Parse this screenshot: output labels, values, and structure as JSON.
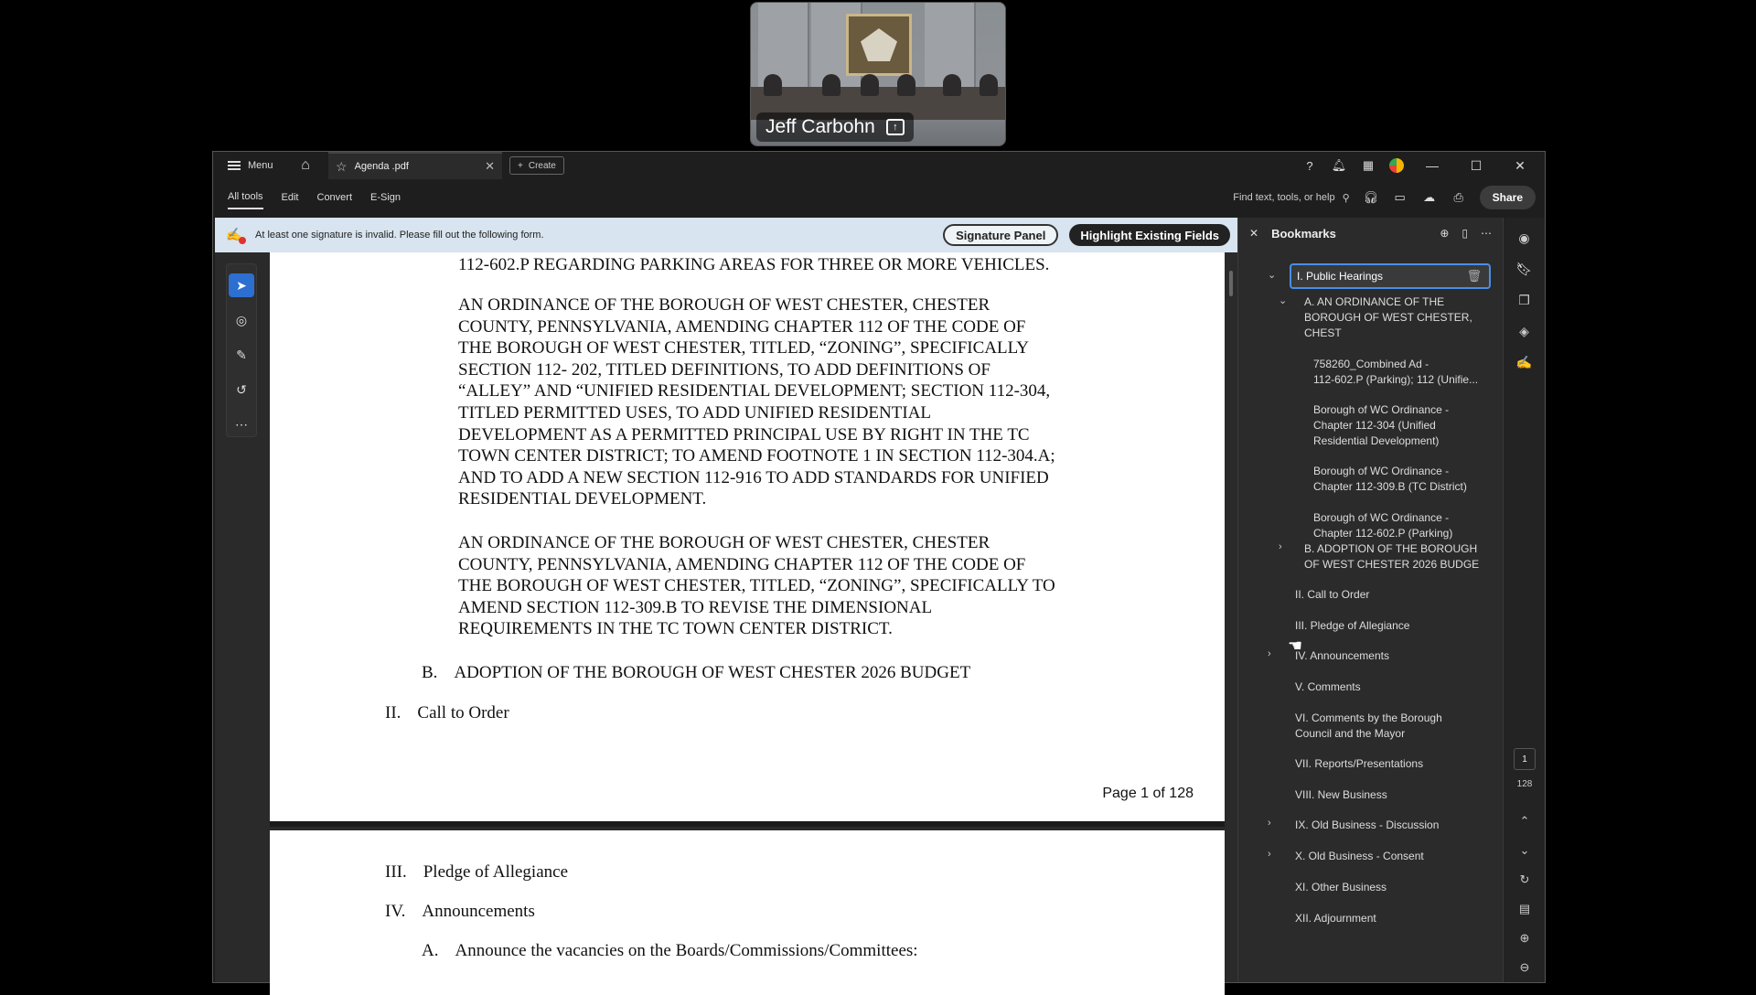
{
  "video": {
    "participant_name": "Jeff Carbohn",
    "share_icon": "share-screen-icon"
  },
  "titlebar": {
    "menu_label": "Menu",
    "tab_label": "Agenda .pdf",
    "create_label": "Create"
  },
  "toolbar": {
    "tabs": [
      "All tools",
      "Edit",
      "Convert",
      "E-Sign"
    ],
    "find_placeholder": "Find text, tools, or help",
    "share_label": "Share"
  },
  "notice": {
    "message": "At least one signature is invalid.  Please fill out the following form.",
    "signature_panel_label": "Signature Panel",
    "highlight_fields_label": "Highlight Existing Fields"
  },
  "document": {
    "top_line": "112-602.P REGARDING PARKING AREAS FOR THREE OR MORE VEHICLES.",
    "para1": "AN ORDINANCE OF THE BOROUGH OF WEST CHESTER, CHESTER\nCOUNTY, PENNSYLVANIA, AMENDING CHAPTER 112 OF THE CODE OF\nTHE BOROUGH OF WEST CHESTER, TITLED, “ZONING”, SPECIFICALLY\nSECTION 112- 202, TITLED DEFINITIONS, TO ADD DEFINITIONS OF\n“ALLEY” AND “UNIFIED RESIDENTIAL DEVELOPMENT; SECTION 112-304,\nTITLED PERMITTED USES, TO ADD UNIFIED RESIDENTIAL\nDEVELOPMENT AS A PERMITTED PRINCIPAL USE BY RIGHT IN THE TC\nTOWN CENTER DISTRICT; TO AMEND FOOTNOTE 1 IN SECTION 112-304.A;\nAND TO ADD A NEW SECTION 112-916 TO ADD STANDARDS FOR UNIFIED\nRESIDENTIAL DEVELOPMENT.",
    "para2": "AN ORDINANCE OF THE BOROUGH OF WEST CHESTER, CHESTER\nCOUNTY, PENNSYLVANIA, AMENDING CHAPTER 112 OF THE CODE OF\nTHE BOROUGH OF WEST CHESTER, TITLED, “ZONING”, SPECIFICALLY TO\nAMEND SECTION 112-309.B TO REVISE THE DIMENSIONAL\nREQUIREMENTS IN THE TC TOWN CENTER DISTRICT.",
    "b_marker": "B.",
    "b_text": "ADOPTION OF THE BOROUGH OF WEST CHESTER 2026 BUDGET",
    "ii_marker": "II.",
    "ii_text": "Call to Order",
    "page_label": "Page 1 of 128",
    "iii_marker": "III.",
    "iii_text": "Pledge of Allegiance",
    "iv_marker": "IV.",
    "iv_text": "Announcements",
    "a_marker": "A.",
    "a_text": "Announce the vacancies on the Boards/Commissions/Committees:"
  },
  "bookmarks": {
    "title": "Bookmarks",
    "selected": "I. Public Hearings",
    "items": [
      "A. AN ORDINANCE OF THE\nBOROUGH OF WEST CHESTER,\nCHEST",
      "758260_Combined Ad -\n112-602.P (Parking); 112 (Unifie...",
      "Borough of WC Ordinance -\nChapter 112-304 (Unified\nResidential Development)",
      "Borough of WC Ordinance -\nChapter 112-309.B (TC District)",
      "Borough of WC Ordinance -\nChapter 112-602.P (Parking)",
      "B. ADOPTION OF THE BOROUGH\nOF WEST CHESTER 2026 BUDGE",
      "II. Call to Order",
      "III. Pledge of Allegiance",
      "IV. Announcements",
      "V.  Comments",
      "VI. Comments by the Borough\nCouncil and the Mayor",
      "VII. Reports/Presentations",
      "VIII. New Business",
      "IX. Old Business - Discussion",
      "X. Old Business - Consent",
      "XI.  Other Business",
      "XII.  Adjournment"
    ]
  },
  "page_nav": {
    "current": "1",
    "total": "128"
  }
}
